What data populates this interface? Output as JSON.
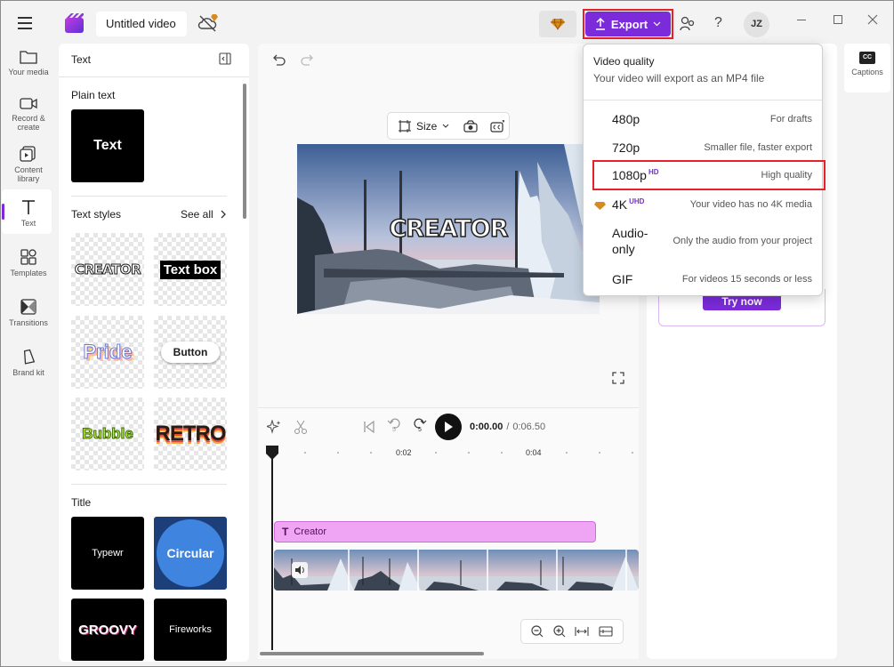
{
  "header": {
    "title": "Untitled video",
    "export_label": "Export",
    "help_label": "?",
    "avatar_initials": "JZ"
  },
  "rail": {
    "items": [
      {
        "label": "Your media",
        "icon": "folder-icon"
      },
      {
        "label": "Record & create",
        "icon": "camera-icon"
      },
      {
        "label": "Content library",
        "icon": "library-icon"
      },
      {
        "label": "Text",
        "icon": "text-icon"
      },
      {
        "label": "Templates",
        "icon": "templates-icon"
      },
      {
        "label": "Transitions",
        "icon": "transitions-icon"
      },
      {
        "label": "Brand kit",
        "icon": "brand-kit-icon"
      }
    ]
  },
  "panel": {
    "title": "Text",
    "plain_text_heading": "Plain text",
    "plain_text_tile": "Text",
    "text_styles_heading": "Text styles",
    "see_all": "See all",
    "styles": [
      "CREATOR",
      "Text box",
      "Pride",
      "Button",
      "Bubble",
      "RETRO"
    ],
    "title_heading": "Title",
    "titles": [
      "Typewr",
      "Circular",
      "GROOVY",
      "Fireworks"
    ]
  },
  "canvas": {
    "size_label": "Size",
    "overlay_text": "CREATOR"
  },
  "timeline": {
    "time_current": "0:00.00",
    "time_total": "0:06.50",
    "ticks": [
      "0:02",
      "0:04"
    ],
    "text_clip_label": "Creator",
    "skip_back_seconds": "5",
    "skip_forward_seconds": "5"
  },
  "right": {
    "try_label": "Try now",
    "captions_label": "Captions",
    "captions_icon_text": "CC"
  },
  "export_menu": {
    "title": "Video quality",
    "subtitle": "Your video will export as an MP4 file",
    "options": [
      {
        "label": "480p",
        "badge": "",
        "desc": "For drafts"
      },
      {
        "label": "720p",
        "badge": "",
        "desc": "Smaller file, faster export"
      },
      {
        "label": "1080p",
        "badge": "HD",
        "desc": "High quality"
      },
      {
        "label": "4K",
        "badge": "UHD",
        "desc": "Your video has no 4K media"
      },
      {
        "label": "Audio-only",
        "badge": "",
        "desc": "Only the audio from your project"
      },
      {
        "label": "GIF",
        "badge": "",
        "desc": "For videos 15 seconds or less"
      }
    ]
  },
  "colors": {
    "accent": "#7b2bd9",
    "highlight_outline": "#e8202a",
    "text_clip": "#efa5f3"
  }
}
